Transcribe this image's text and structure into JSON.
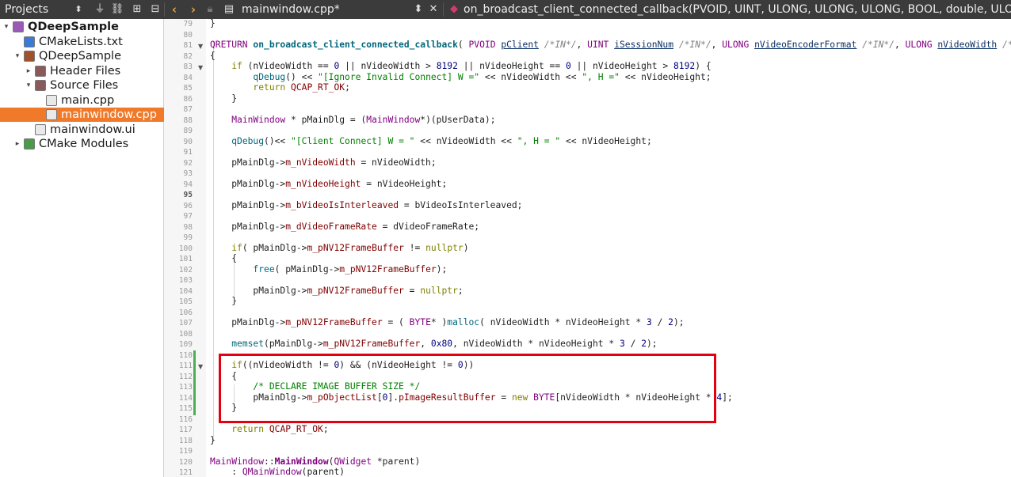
{
  "toolbar": {
    "projects_label": "Projects",
    "file_tab": "mainwindow.cpp*",
    "symbol_label": "on_broadcast_client_connected_callback(PVOID, UINT, ULONG, ULONG, ULONG, BOOL, double, ULONG, U"
  },
  "tree": [
    {
      "label": "QDeepSample",
      "icon": "qt-project-icon",
      "arrow": "▾",
      "level": 0,
      "bold": true,
      "selected": false
    },
    {
      "label": "CMakeLists.txt",
      "icon": "cmake-file-icon",
      "arrow": "",
      "level": 1,
      "bold": false,
      "selected": false
    },
    {
      "label": "QDeepSample",
      "icon": "build-target-icon",
      "arrow": "▾",
      "level": 1,
      "bold": false,
      "selected": false
    },
    {
      "label": "Header Files",
      "icon": "folder-icon",
      "arrow": "▸",
      "level": 2,
      "bold": false,
      "selected": false
    },
    {
      "label": "Source Files",
      "icon": "folder-icon",
      "arrow": "▾",
      "level": 2,
      "bold": false,
      "selected": false
    },
    {
      "label": "main.cpp",
      "icon": "cpp-file-icon",
      "arrow": "",
      "level": 3,
      "bold": false,
      "selected": false
    },
    {
      "label": "mainwindow.cpp",
      "icon": "cpp-file-icon",
      "arrow": "",
      "level": 3,
      "bold": false,
      "selected": true
    },
    {
      "label": "mainwindow.ui",
      "icon": "ui-file-icon",
      "arrow": "",
      "level": 2,
      "bold": false,
      "selected": false
    },
    {
      "label": "CMake Modules",
      "icon": "cmake-modules-icon",
      "arrow": "▸",
      "level": 1,
      "bold": false,
      "selected": false
    }
  ],
  "editor": {
    "current_line": "95",
    "lines": [
      {
        "n": "79",
        "html": "}"
      },
      {
        "n": "80",
        "html": ""
      },
      {
        "n": "81",
        "html": "<span class=\"t\">QRETURN</span> <span class=\"fn\">on_broadcast_client_connected_callback</span>( <span class=\"t\">PVOID</span> <span class=\"pa\">pClient</span> <span class=\"cm\">/*IN*/</span>, <span class=\"t\">UINT</span> <span class=\"pa\">iSessionNum</span> <span class=\"cm\">/*IN*/</span>, <span class=\"t\">ULONG</span> <span class=\"pa\">nVideoEncoderFormat</span> <span class=\"cm\">/*IN*/</span>, <span class=\"t\">ULONG</span> <span class=\"pa\">nVideoWidth</span> <span class=\"cm\">/*IN*/</span>, <span class=\"t\">ULON</span>"
      },
      {
        "n": "82",
        "html": "{"
      },
      {
        "n": "83",
        "html": "    <span class=\"k\">if</span> (nVideoWidth == <span class=\"n\">0</span> || nVideoWidth > <span class=\"n\">8192</span> || nVideoHeight == <span class=\"n\">0</span> || nVideoHeight > <span class=\"n\">8192</span>) {"
      },
      {
        "n": "84",
        "html": "        <span class=\"f\">qDebug</span>() << <span class=\"s\">\"[Ignore Invalid Connect] W =\"</span> << nVideoWidth << <span class=\"s\">\", H =\"</span> << nVideoHeight;"
      },
      {
        "n": "85",
        "html": "        <span class=\"k\">return</span> <span class=\"m\">QCAP_RT_OK</span>;"
      },
      {
        "n": "86",
        "html": "    }"
      },
      {
        "n": "87",
        "html": ""
      },
      {
        "n": "88",
        "html": "    <span class=\"t\">MainWindow</span> * pMainDlg = (<span class=\"t\">MainWindow</span>*)(pUserData);"
      },
      {
        "n": "89",
        "html": ""
      },
      {
        "n": "90",
        "html": "    <span class=\"f\">qDebug</span>()<< <span class=\"s\">\"[Client Connect] W = \"</span> << nVideoWidth << <span class=\"s\">\", H = \"</span> << nVideoHeight;"
      },
      {
        "n": "91",
        "html": ""
      },
      {
        "n": "92",
        "html": "    pMainDlg-><span class=\"m\">m_nVideoWidth</span> = nVideoWidth;"
      },
      {
        "n": "93",
        "html": ""
      },
      {
        "n": "94",
        "html": "    pMainDlg-><span class=\"m\">m_nVideoHeight</span> = nVideoHeight;"
      },
      {
        "n": "95",
        "html": ""
      },
      {
        "n": "96",
        "html": "    pMainDlg-><span class=\"m\">m_bVideoIsInterleaved</span> = bVideoIsInterleaved;"
      },
      {
        "n": "97",
        "html": ""
      },
      {
        "n": "98",
        "html": "    pMainDlg-><span class=\"m\">m_dVideoFrameRate</span> = dVideoFrameRate;"
      },
      {
        "n": "99",
        "html": ""
      },
      {
        "n": "100",
        "html": "    <span class=\"k\">if</span>( pMainDlg-><span class=\"m\">m_pNV12FrameBuffer</span> != <span class=\"k\">nullptr</span>)"
      },
      {
        "n": "101",
        "html": "    {"
      },
      {
        "n": "102",
        "html": "        <span class=\"f\">free</span>( pMainDlg-><span class=\"m\">m_pNV12FrameBuffer</span>);"
      },
      {
        "n": "103",
        "html": ""
      },
      {
        "n": "104",
        "html": "        pMainDlg-><span class=\"m\">m_pNV12FrameBuffer</span> = <span class=\"k\">nullptr</span>;"
      },
      {
        "n": "105",
        "html": "    }"
      },
      {
        "n": "106",
        "html": ""
      },
      {
        "n": "107",
        "html": "    pMainDlg-><span class=\"m\">m_pNV12FrameBuffer</span> = ( <span class=\"t\">BYTE</span>* )<span class=\"f\">malloc</span>( nVideoWidth * nVideoHeight * <span class=\"n\">3</span> / <span class=\"n\">2</span>);"
      },
      {
        "n": "108",
        "html": ""
      },
      {
        "n": "109",
        "html": "    <span class=\"f\">memset</span>(pMainDlg-><span class=\"m\">m_pNV12FrameBuffer</span>, <span class=\"n\">0x80</span>, nVideoWidth * nVideoHeight * <span class=\"n\">3</span> / <span class=\"n\">2</span>);"
      },
      {
        "n": "110",
        "html": ""
      },
      {
        "n": "111",
        "html": "    <span class=\"k\">if</span>((nVideoWidth != <span class=\"n\">0</span>) && (nVideoHeight != <span class=\"n\">0</span>))"
      },
      {
        "n": "112",
        "html": "    {"
      },
      {
        "n": "113",
        "html": "        <span class=\"c\">/* DECLARE IMAGE BUFFER SIZE */</span>"
      },
      {
        "n": "114",
        "html": "        pMainDlg-><span class=\"m\">m_pObjectList</span>[<span class=\"n\">0</span>].<span class=\"m\">pImageResultBuffer</span> = <span class=\"k\">new</span> <span class=\"t\">BYTE</span>[nVideoWidth * nVideoHeight * <span class=\"n\">4</span>];"
      },
      {
        "n": "115",
        "html": "    }"
      },
      {
        "n": "116",
        "html": ""
      },
      {
        "n": "117",
        "html": "    <span class=\"k\">return</span> <span class=\"m\">QCAP_RT_OK</span>;"
      },
      {
        "n": "118",
        "html": "}"
      },
      {
        "n": "119",
        "html": ""
      },
      {
        "n": "120",
        "html": "<span class=\"t\">MainWindow</span>::<span class=\"cls\">MainWindow</span>(<span class=\"t\">QWidget</span> *parent)"
      },
      {
        "n": "121",
        "html": "    : <span class=\"t\">QMainWindow</span>(parent)"
      }
    ]
  }
}
